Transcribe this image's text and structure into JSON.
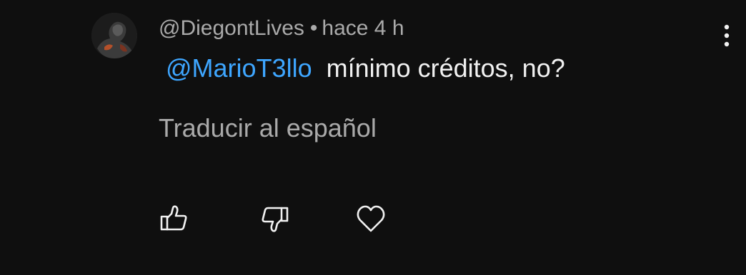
{
  "comment": {
    "author": "@DiegontLives",
    "separator": "•",
    "time": "hace 4 h",
    "mention": "@MarioT3llo",
    "text": "mínimo créditos, no?",
    "translate_label": "Traducir al español"
  },
  "icons": {
    "avatar": "avatar",
    "more": "more-vert-icon",
    "like": "thumbs-up-icon",
    "dislike": "thumbs-down-icon",
    "heart": "heart-icon"
  },
  "colors": {
    "background": "#0f0f0f",
    "text": "#f1f1f1",
    "secondary_text": "#aaaaaa",
    "link": "#3ea6ff"
  }
}
